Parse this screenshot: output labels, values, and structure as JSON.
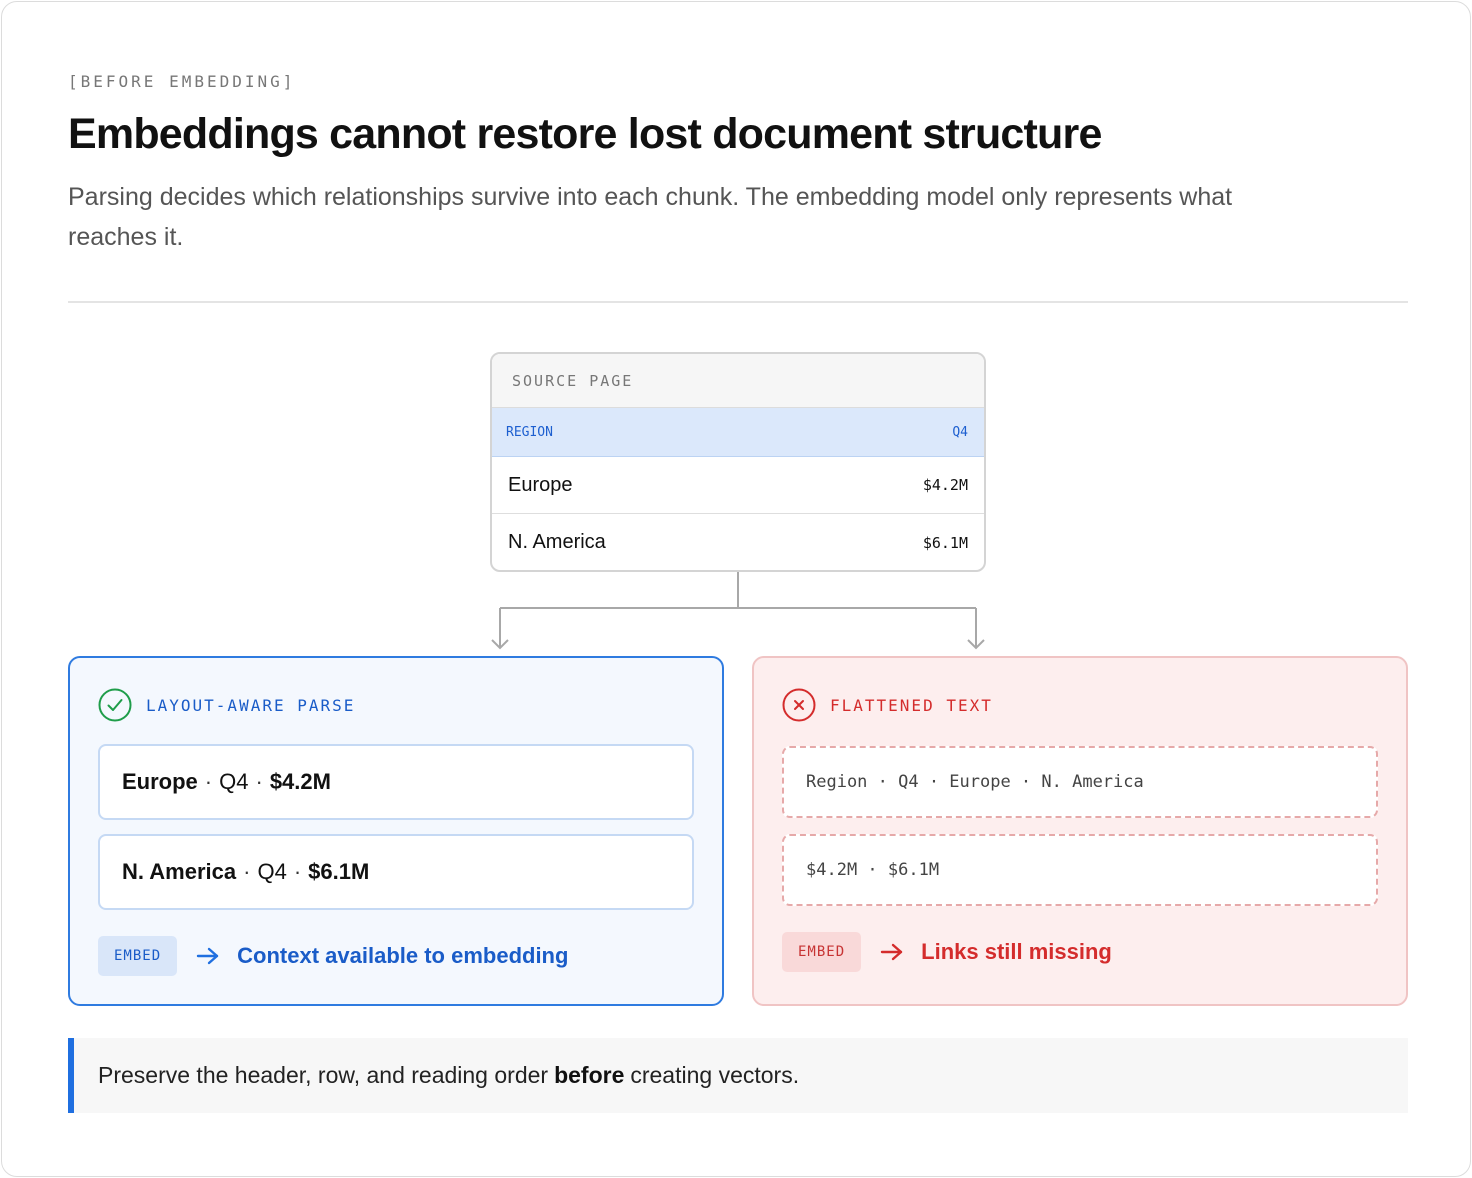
{
  "eyebrow": "[BEFORE EMBEDDING]",
  "title": "Embeddings cannot restore lost document structure",
  "subtitle": "Parsing decides which relationships survive into each chunk. The embedding model only represents what reaches it.",
  "source": {
    "heading": "SOURCE PAGE",
    "col_region": "REGION",
    "col_q4": "Q4",
    "rows": [
      {
        "region": "Europe",
        "value": "$4.2M"
      },
      {
        "region": "N. America",
        "value": "$6.1M"
      }
    ]
  },
  "good": {
    "title": "LAYOUT-AWARE PARSE",
    "icon": "check-circle-icon",
    "chunks": [
      {
        "region": "Europe",
        "sep1": "·",
        "quarter": "Q4",
        "sep2": "·",
        "value": "$4.2M"
      },
      {
        "region": "N. America",
        "sep1": "·",
        "quarter": "Q4",
        "sep2": "·",
        "value": "$6.1M"
      }
    ],
    "tag": "EMBED",
    "result": "Context available to embedding",
    "color": "#1a5cc8"
  },
  "bad": {
    "title": "FLATTENED TEXT",
    "icon": "x-circle-icon",
    "chunks": [
      "Region · Q4 · Europe · N. America",
      "$4.2M · $6.1M"
    ],
    "tag": "EMBED",
    "result": "Links still missing",
    "color": "#d42c2c"
  },
  "callout": {
    "before": "Preserve the header, row, and reading order",
    "bold": "before",
    "after": "creating vectors."
  }
}
